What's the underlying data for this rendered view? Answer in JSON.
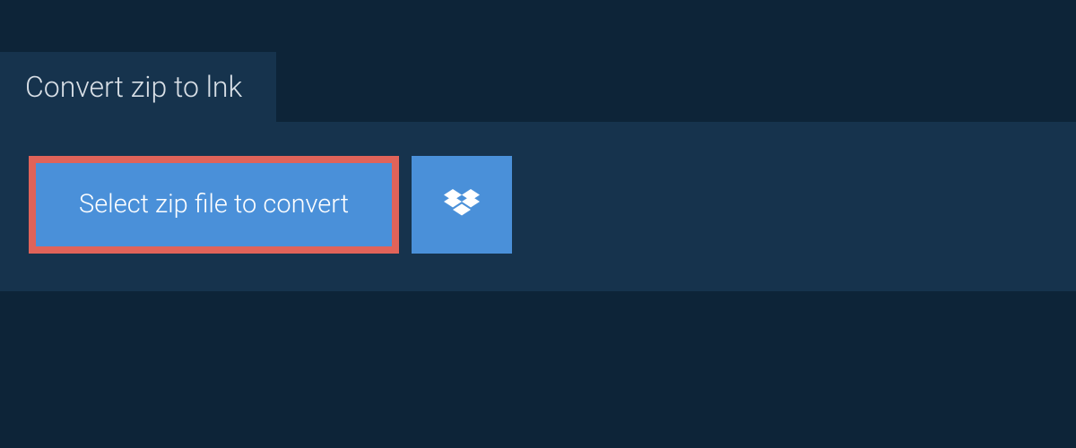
{
  "tab": {
    "label": "Convert zip to lnk"
  },
  "buttons": {
    "select_label": "Select zip file to convert"
  },
  "colors": {
    "bg_dark": "#0d2438",
    "bg_panel": "#16334d",
    "button_blue": "#4a90d9",
    "highlight_border": "#e06359",
    "text_light": "#d8dfe6"
  }
}
